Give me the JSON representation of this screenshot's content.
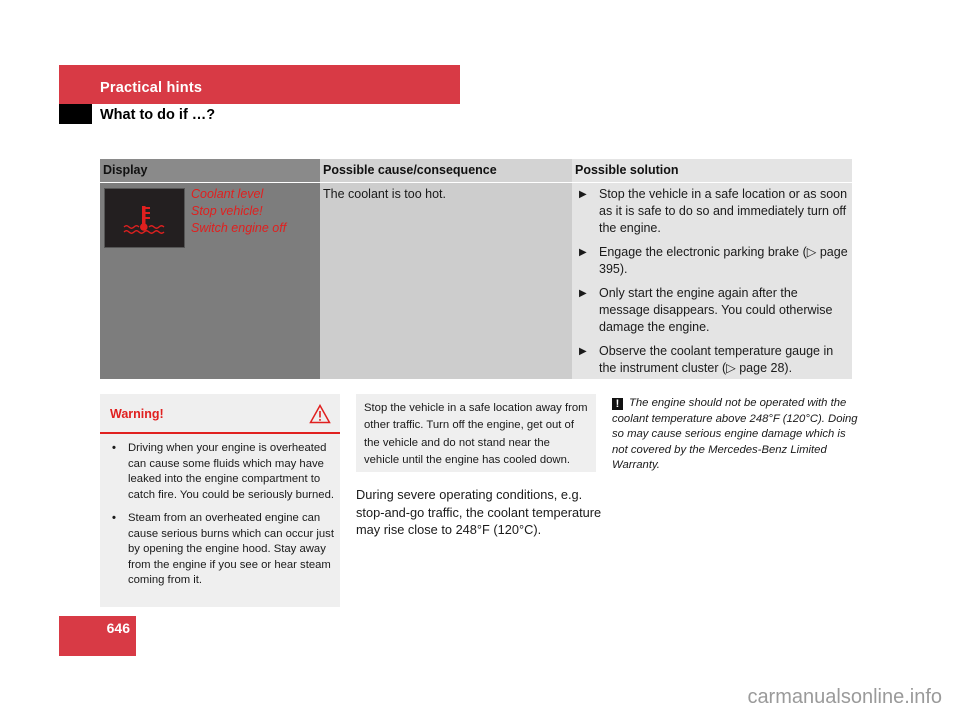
{
  "header": {
    "section": "Practical hints",
    "subsection": "What to do if …?"
  },
  "table": {
    "columns": [
      "Display",
      "Possible cause/consequence",
      "Possible solution"
    ],
    "row": {
      "display_icon": "coolant-temperature-warning-icon",
      "display_messages": [
        "Coolant level",
        "Stop vehicle!",
        "Switch engine off"
      ],
      "cause": "The coolant is too hot.",
      "solutions": [
        "Stop the vehicle in a safe location or as soon as it is safe to do so and immediately turn off the engine.",
        "Engage the electronic parking brake (▷ page 395).",
        "Only start the engine again after the message disappears. You could otherwise damage the engine.",
        "Observe the coolant temperature gauge in the instrument cluster (▷ page 28)."
      ]
    }
  },
  "warning": {
    "title": "Warning!",
    "icon": "warning-triangle-icon",
    "items": [
      "Driving when your engine is overheated can cause some fluids which may have leaked into the engine compartment to catch fire. You could be seriously burned.",
      "Steam from an overheated engine can cause serious burns which can occur just by opening the engine hood. Stay away from the engine if you see or hear steam coming from it."
    ]
  },
  "note": "Stop the vehicle in a safe location away from other traffic. Turn off the engine, get out of the vehicle and do not stand near the vehicle until the engine has cooled down.",
  "body_text": "During severe operating conditions, e.g. stop-and-go traffic, the coolant temperature may rise close to 248°F (120°C).",
  "notice": {
    "icon_label": "!",
    "text": "The engine should not be operated with the coolant temperature above 248°F (120°C). Doing so may cause serious engine damage which is not covered by the Mercedes-Benz Limited Warranty."
  },
  "page_number": "646",
  "watermark": "carmanualsonline.info",
  "colors": {
    "brand_red": "#d83a45",
    "warning_red": "#e0201f"
  }
}
